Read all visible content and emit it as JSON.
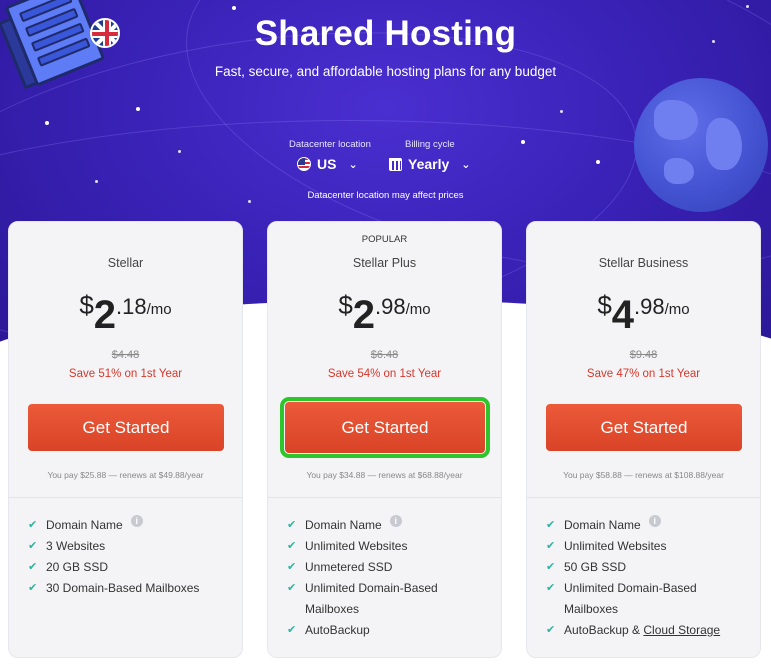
{
  "header": {
    "title": "Shared Hosting",
    "subtitle": "Fast, secure, and affordable hosting plans for any budget"
  },
  "datacenter": {
    "label": "Datacenter location",
    "value": "US",
    "flag_icon": "us-flag-icon"
  },
  "billing": {
    "label": "Billing cycle",
    "value": "Yearly",
    "icon": "calendar-icon"
  },
  "datacenter_note": "Datacenter location may affect prices",
  "colors": {
    "hero": "#3a22b8",
    "cta": "#e14a2c",
    "save_text": "#d7372a",
    "check": "#2fb3a1",
    "highlight": "#2ec52c"
  },
  "plans": [
    {
      "badge": "",
      "name": "Stellar",
      "currency": "$",
      "price_int": "2",
      "price_dec": ".18",
      "per": "/mo",
      "old_price": "$4.48",
      "save": "Save 51% on 1st Year",
      "cta": "Get Started",
      "renew": "You pay $25.88 — renews at $49.88/year",
      "features": [
        "Domain Name",
        "3 Websites",
        "20 GB SSD",
        "30 Domain-Based Mailboxes"
      ]
    },
    {
      "badge": "POPULAR",
      "name": "Stellar Plus",
      "currency": "$",
      "price_int": "2",
      "price_dec": ".98",
      "per": "/mo",
      "old_price": "$6.48",
      "save": "Save 54% on 1st Year",
      "cta": "Get Started",
      "renew": "You pay $34.88 — renews at $68.88/year",
      "features": [
        "Domain Name",
        "Unlimited Websites",
        "Unmetered SSD",
        "Unlimited Domain-Based",
        "Mailboxes",
        "AutoBackup"
      ]
    },
    {
      "badge": "",
      "name": "Stellar Business",
      "currency": "$",
      "price_int": "4",
      "price_dec": ".98",
      "per": "/mo",
      "old_price": "$9.48",
      "save": "Save 47% on 1st Year",
      "cta": "Get Started",
      "renew": "You pay $58.88 — renews at $108.88/year",
      "features": [
        "Domain Name",
        "Unlimited Websites",
        "50 GB SSD",
        "Unlimited Domain-Based",
        "Mailboxes",
        "AutoBackup & ",
        "Cloud Storage"
      ]
    }
  ]
}
